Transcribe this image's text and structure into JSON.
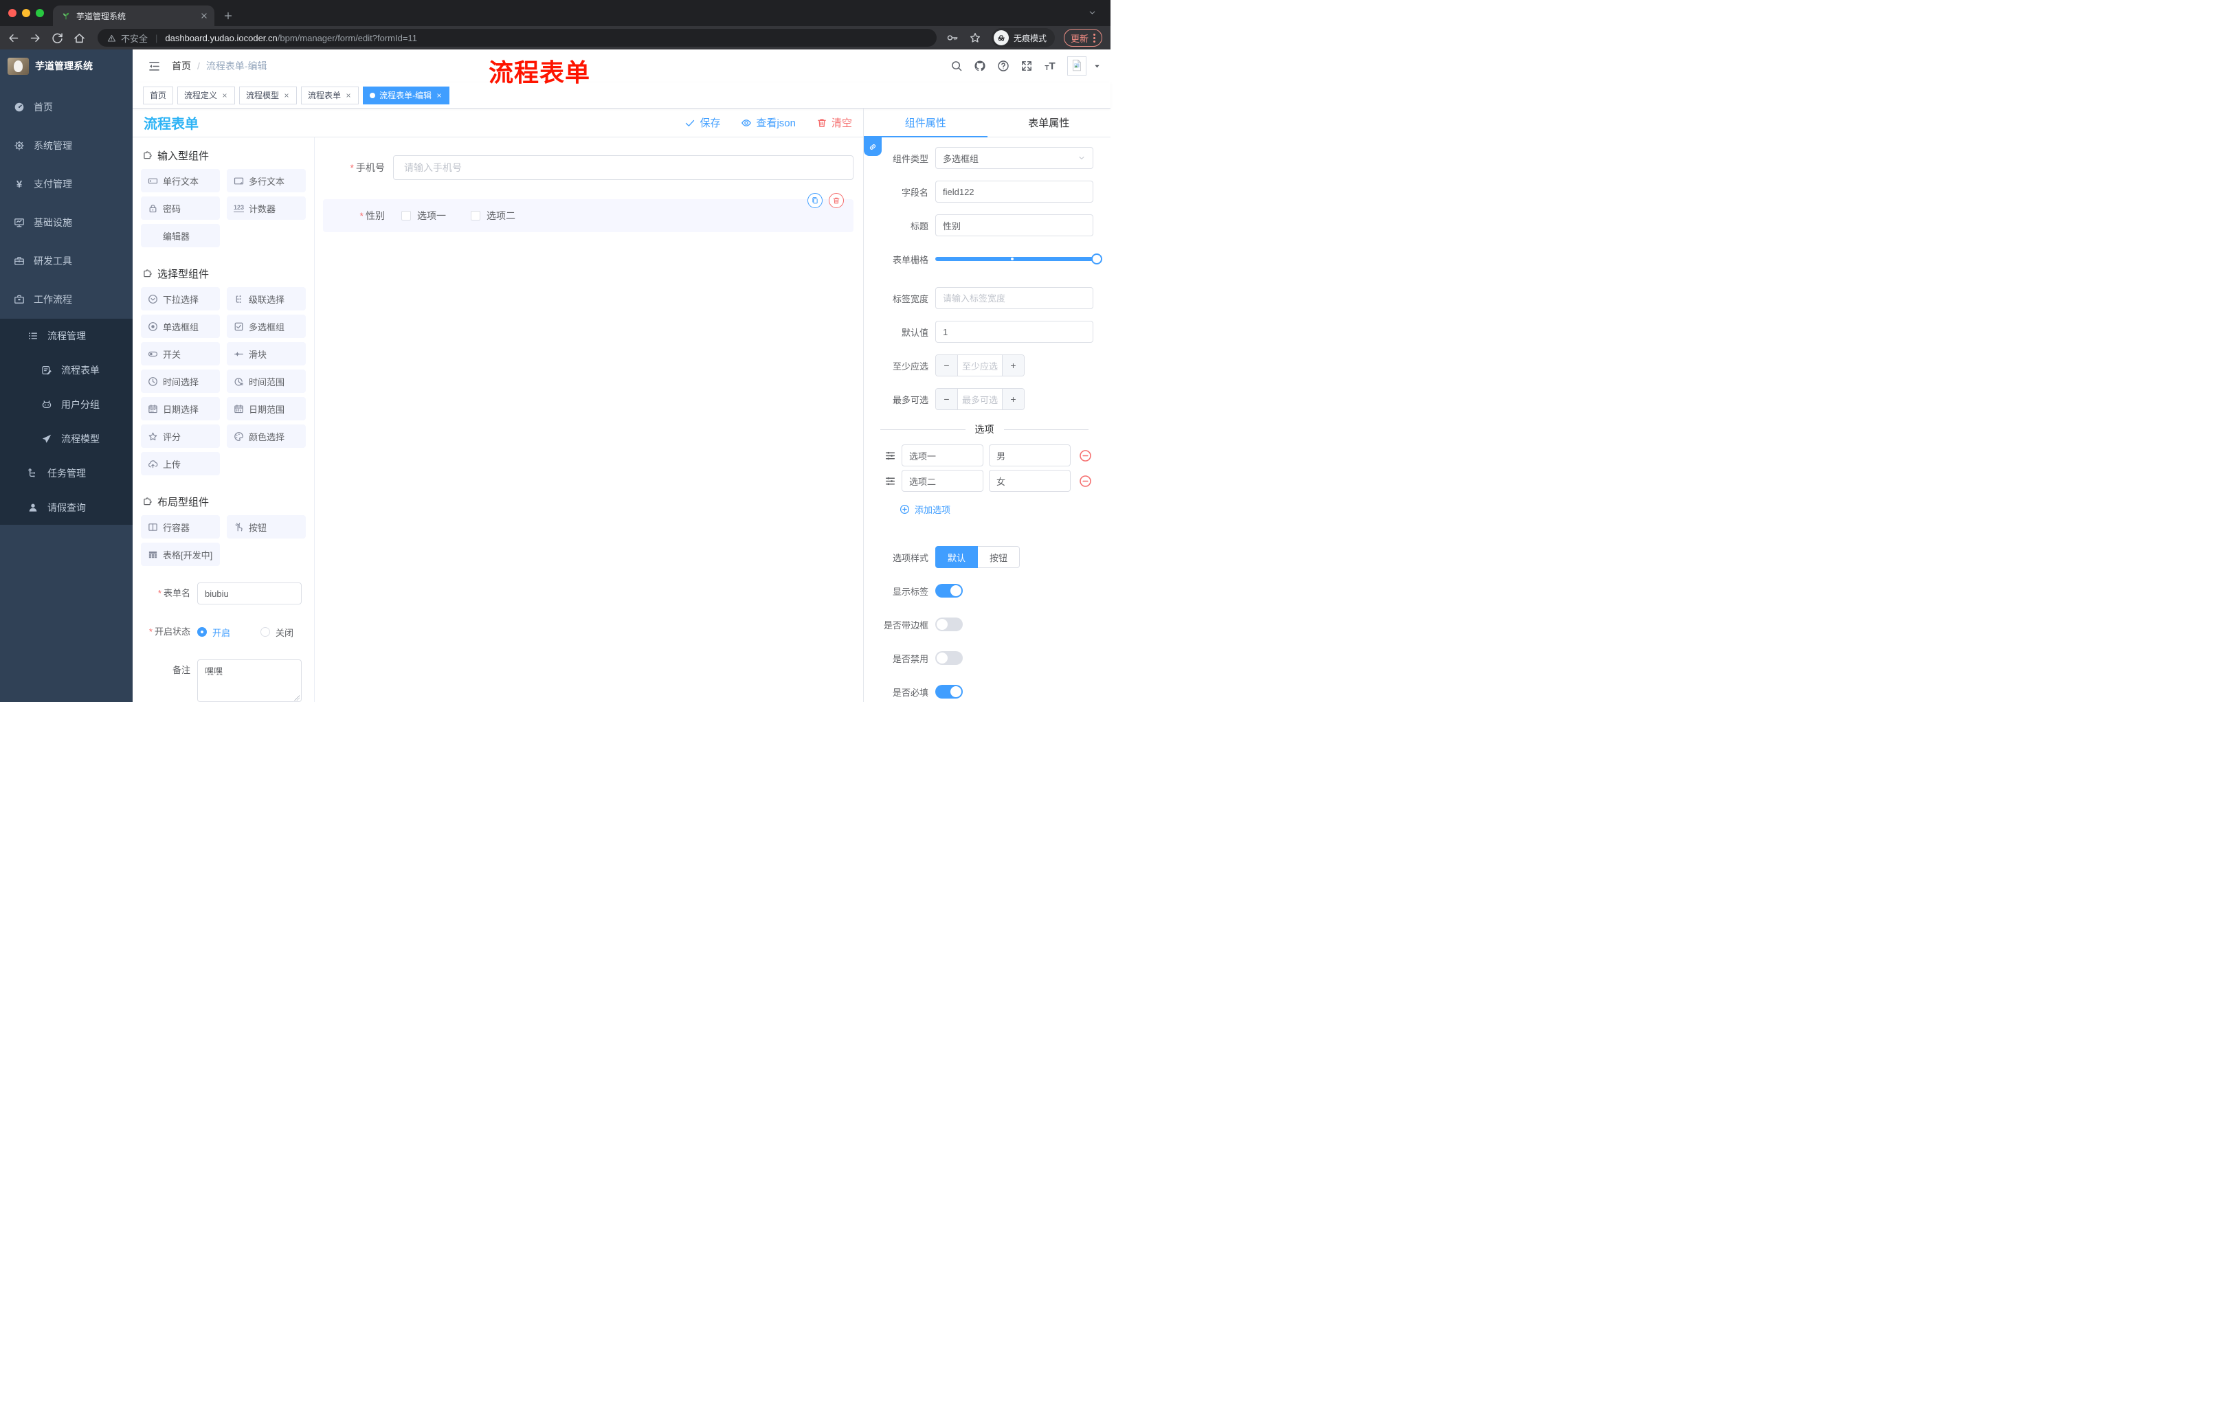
{
  "colors": {
    "primary": "#409eff",
    "danger": "#f56c6c",
    "title_blue": "#2db3f5",
    "watermark_red": "#fe1400",
    "sidebar_bg": "#304156",
    "sidebar_sub_bg": "#1f2d3d"
  },
  "browser": {
    "tab_title": "芋道管理系统",
    "security_label": "不安全",
    "url_host": "dashboard.yudao.iocoder.cn",
    "url_path": "/bpm/manager/form/edit?formId=11",
    "incognito_label": "无痕模式",
    "update_label": "更新"
  },
  "sidebar": {
    "logo_title": "芋道管理系统",
    "items": [
      {
        "label": "首页",
        "icon": "dashboard-icon",
        "level": 1
      },
      {
        "label": "系统管理",
        "icon": "gear-icon",
        "level": 1,
        "chevron": "down"
      },
      {
        "label": "支付管理",
        "icon": "yen-icon",
        "level": 1,
        "chevron": "down"
      },
      {
        "label": "基础设施",
        "icon": "monitor-icon",
        "level": 1,
        "chevron": "down"
      },
      {
        "label": "研发工具",
        "icon": "toolbox-icon",
        "level": 1,
        "chevron": "down"
      },
      {
        "label": "工作流程",
        "icon": "briefcase-icon",
        "level": 1,
        "chevron": "up"
      },
      {
        "label": "流程管理",
        "icon": "list-icon",
        "level": 2,
        "chevron": "up",
        "dark": true
      },
      {
        "label": "流程表单",
        "icon": "form-icon",
        "level": 3,
        "dark": true
      },
      {
        "label": "用户分组",
        "icon": "robot-icon",
        "level": 3,
        "dark": true
      },
      {
        "label": "流程模型",
        "icon": "send-icon",
        "level": 3,
        "dark": true
      },
      {
        "label": "任务管理",
        "icon": "tree-icon",
        "level": 2,
        "chevron": "down",
        "dark": true
      },
      {
        "label": "请假查询",
        "icon": "user-icon",
        "level": 2,
        "dark": true
      }
    ]
  },
  "header": {
    "breadcrumb_home": "首页",
    "breadcrumb_current": "流程表单-编辑",
    "watermark": "流程表单",
    "right_icons": [
      "search-icon",
      "github-icon",
      "help-icon",
      "fullscreen-icon",
      "font-size-icon"
    ]
  },
  "tags": [
    {
      "label": "首页",
      "closable": false,
      "active": false
    },
    {
      "label": "流程定义",
      "closable": true,
      "active": false
    },
    {
      "label": "流程模型",
      "closable": true,
      "active": false
    },
    {
      "label": "流程表单",
      "closable": true,
      "active": false
    },
    {
      "label": "流程表单-编辑",
      "closable": true,
      "active": true
    }
  ],
  "designer": {
    "title": "流程表单",
    "actions": [
      {
        "label": "保存",
        "icon": "check-icon",
        "color": "blue"
      },
      {
        "label": "查看json",
        "icon": "eye-icon",
        "color": "blue"
      },
      {
        "label": "清空",
        "icon": "trash-icon",
        "color": "red"
      }
    ]
  },
  "palette": {
    "sections": [
      {
        "title": "输入型组件",
        "items": [
          {
            "label": "单行文本",
            "icon": "input-icon"
          },
          {
            "label": "多行文本",
            "icon": "textarea-icon"
          },
          {
            "label": "密码",
            "icon": "lock-icon"
          },
          {
            "label": "计数器",
            "icon": "counter-icon"
          },
          {
            "label": "编辑器",
            "icon": "none"
          }
        ]
      },
      {
        "title": "选择型组件",
        "items": [
          {
            "label": "下拉选择",
            "icon": "select-icon"
          },
          {
            "label": "级联选择",
            "icon": "cascader-icon"
          },
          {
            "label": "单选框组",
            "icon": "radio-icon"
          },
          {
            "label": "多选框组",
            "icon": "checkbox-icon"
          },
          {
            "label": "开关",
            "icon": "switch-icon"
          },
          {
            "label": "滑块",
            "icon": "slider-icon"
          },
          {
            "label": "时间选择",
            "icon": "time-icon"
          },
          {
            "label": "时间范围",
            "icon": "time-range-icon"
          },
          {
            "label": "日期选择",
            "icon": "date-icon"
          },
          {
            "label": "日期范围",
            "icon": "date-range-icon"
          },
          {
            "label": "评分",
            "icon": "star-icon"
          },
          {
            "label": "颜色选择",
            "icon": "palette-icon"
          },
          {
            "label": "上传",
            "icon": "upload-icon"
          }
        ]
      },
      {
        "title": "布局型组件",
        "items": [
          {
            "label": "行容器",
            "icon": "row-icon"
          },
          {
            "label": "按钮",
            "icon": "hand-icon"
          },
          {
            "label": "表格[开发中]",
            "icon": "table-icon"
          }
        ]
      }
    ],
    "form": {
      "name_label": "表单名",
      "name_value": "biubiu",
      "status_label": "开启状态",
      "status_on": "开启",
      "status_off": "关闭",
      "remark_label": "备注",
      "remark_value": "嘿嘿"
    }
  },
  "canvas": {
    "phone_label": "手机号",
    "phone_placeholder": "请输入手机号",
    "gender_label": "性别",
    "gender_options": [
      "选项一",
      "选项二"
    ],
    "block_actions": [
      "copy-icon",
      "delete-icon"
    ]
  },
  "inspector": {
    "tab_component": "组件属性",
    "tab_form": "表单属性",
    "rows": {
      "component_type": {
        "label": "组件类型",
        "value": "多选框组"
      },
      "field_name": {
        "label": "字段名",
        "value": "field122"
      },
      "title": {
        "label": "标题",
        "value": "性别"
      },
      "grid": {
        "label": "表单栅格",
        "percent": 100,
        "stop_percent": 47
      },
      "label_width": {
        "label": "标签宽度",
        "placeholder": "请输入标签宽度"
      },
      "default": {
        "label": "默认值",
        "value": "1"
      },
      "min": {
        "label": "至少应选",
        "placeholder": "至少应选"
      },
      "max": {
        "label": "最多可选",
        "placeholder": "最多可选"
      }
    },
    "options_title": "选项",
    "options": [
      {
        "name": "选项一",
        "value": "男"
      },
      {
        "name": "选项二",
        "value": "女"
      }
    ],
    "add_option": "添加选项",
    "style": {
      "label": "选项样式",
      "options": [
        {
          "label": "默认",
          "active": true
        },
        {
          "label": "按钮",
          "active": false
        }
      ]
    },
    "switches": [
      {
        "label": "显示标签",
        "on": true
      },
      {
        "label": "是否带边框",
        "on": false
      },
      {
        "label": "是否禁用",
        "on": false
      },
      {
        "label": "是否必填",
        "on": true
      }
    ]
  }
}
